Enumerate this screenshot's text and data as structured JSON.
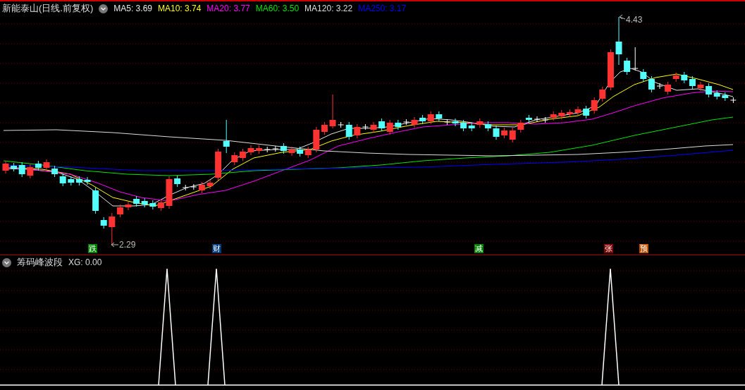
{
  "main_panel": {
    "title": "新能泰山(日线.前复权)",
    "indicators": [
      {
        "label": "MA5:",
        "value": "3.69",
        "color": "#e6e6e6"
      },
      {
        "label": "MA10:",
        "value": "3.74",
        "color": "#ffff00"
      },
      {
        "label": "MA20:",
        "value": "3.77",
        "color": "#ff00ff"
      },
      {
        "label": "MA60:",
        "value": "3.50",
        "color": "#00e600"
      },
      {
        "label": "MA120:",
        "value": "3.22",
        "color": "#dcdcdc"
      },
      {
        "label": "MA250:",
        "value": "3.17",
        "color": "#0000ff"
      }
    ],
    "price_labels": [
      {
        "kind": "high",
        "text": "4.43"
      },
      {
        "kind": "low",
        "text": "2.29"
      }
    ],
    "markers": [
      {
        "text": "跌",
        "color": "#008000"
      },
      {
        "text": "财",
        "color": "#003a78"
      },
      {
        "text": "减",
        "color": "#008000"
      },
      {
        "text": "张",
        "color": "#800000"
      },
      {
        "text": "预",
        "color": "#c05000"
      }
    ]
  },
  "sub_panel": {
    "title": "筹码峰波段",
    "reading": "XG: 0.00"
  }
}
